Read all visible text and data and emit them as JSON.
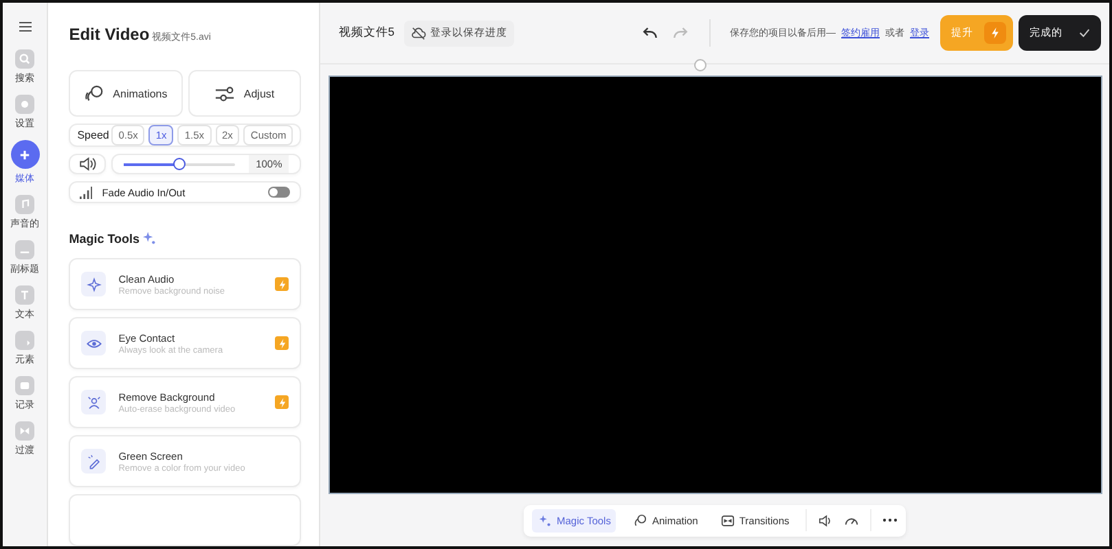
{
  "rail": {
    "items": [
      {
        "label": "搜索",
        "kind": "search",
        "selected": false
      },
      {
        "label": "设置",
        "kind": "settings",
        "selected": false
      },
      {
        "label": "媒体",
        "kind": "plus",
        "selected": true
      },
      {
        "label": "声音的",
        "kind": "music",
        "selected": false
      },
      {
        "label": "副标题",
        "kind": "subtitle",
        "selected": false
      },
      {
        "label": "文本",
        "kind": "text",
        "selected": false
      },
      {
        "label": "元素",
        "kind": "element",
        "selected": false
      },
      {
        "label": "记录",
        "kind": "record",
        "selected": false
      },
      {
        "label": "过渡",
        "kind": "transition",
        "selected": false
      }
    ]
  },
  "panel": {
    "title": "Edit Video",
    "filename": "视频文件5.avi",
    "actions": [
      {
        "label": "Animations",
        "kind": "animation"
      },
      {
        "label": "Adjust",
        "kind": "adjust"
      }
    ],
    "speed": {
      "label": "Speed",
      "options": [
        {
          "label": "0.5x",
          "selected": false
        },
        {
          "label": "1x",
          "selected": true
        },
        {
          "label": "1.5x",
          "selected": false
        },
        {
          "label": "2x",
          "selected": false
        },
        {
          "label": "Custom",
          "selected": false
        }
      ]
    },
    "volume": {
      "level": 0.5,
      "reading": "100%"
    },
    "fade": {
      "label": "Fade Audio In/Out",
      "on": false
    },
    "magic_title": "Magic Tools",
    "tools": [
      {
        "name": "Clean Audio",
        "desc": "Remove background noise",
        "kind": "sparkle",
        "premium": true
      },
      {
        "name": "Eye Contact",
        "desc": "Always look at the camera",
        "kind": "eye",
        "premium": true
      },
      {
        "name": "Remove Background",
        "desc": "Auto-erase background video",
        "kind": "person",
        "premium": true
      },
      {
        "name": "Green Screen",
        "desc": "Remove a color from your video",
        "kind": "dropper",
        "premium": false
      },
      {
        "kind": "blank",
        "premium": false
      }
    ]
  },
  "topbar": {
    "project": "视频文件5",
    "save": "登录以保存进度",
    "notice": "保存您的项目以备后用—",
    "signup": "签约雇用",
    "or": "或者",
    "login": "登录",
    "upgrade": "提升",
    "done": "完成的"
  },
  "toolbar": {
    "items": [
      {
        "label": "Magic Tools",
        "kind": "magic",
        "selected": true
      },
      {
        "label": "Animation",
        "kind": "animation",
        "selected": false
      },
      {
        "label": "Transitions",
        "kind": "transitions",
        "selected": false
      }
    ]
  }
}
